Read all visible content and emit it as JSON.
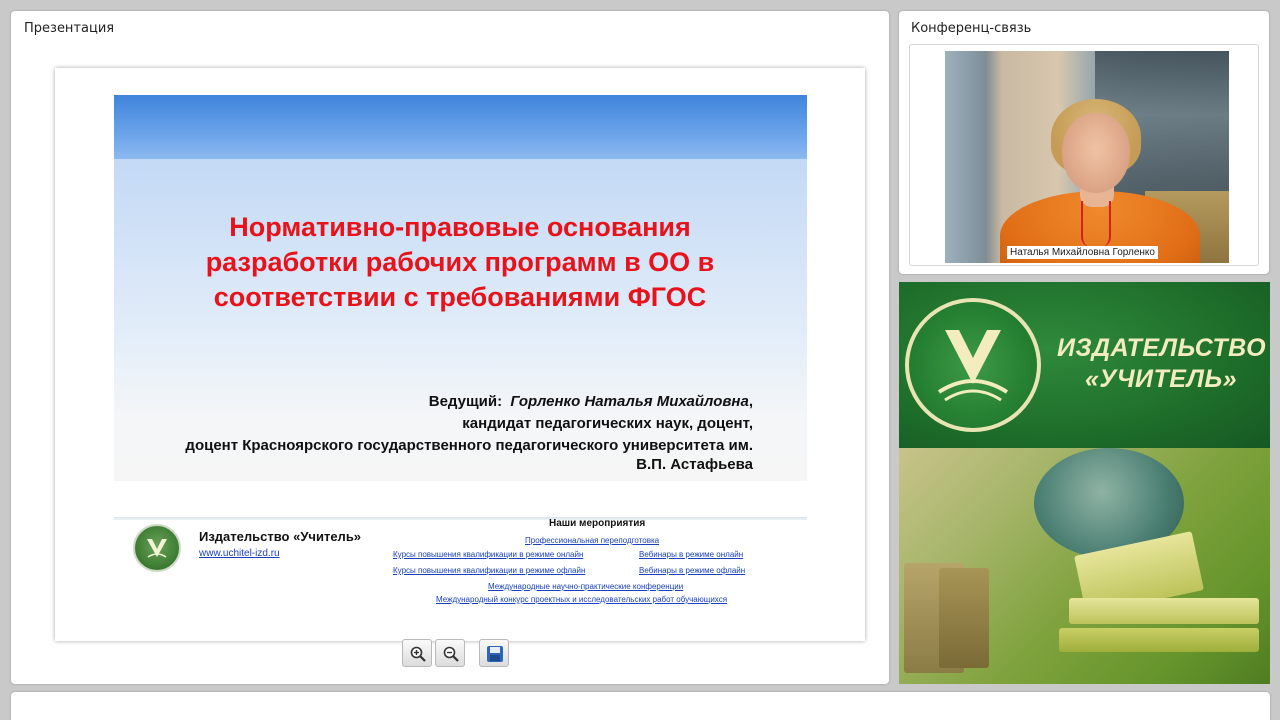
{
  "presentation_panel": {
    "title": "Презентация",
    "slide": {
      "title_lines": [
        "Нормативно-правовые основания",
        "разработки рабочих программ в ОО в",
        "соответствии с требованиями ФГОС"
      ],
      "presenter_label": "Ведущий:",
      "presenter_name": "Горленко  Наталья Михайловна",
      "presenter_line2": "кандидат педагогических наук, доцент,",
      "presenter_line3": "доцент Красноярского  государственного педагогического университета им.",
      "presenter_line4": "В.П. Астафьева",
      "footer": {
        "publisher": "Издательство «Учитель»",
        "site": "www.uchitel-izd.ru",
        "events_heading": "Наши мероприятия",
        "events": [
          "Профессиональная переподготовка",
          "Курсы повышения квалификации в режиме онлайн",
          "Вебинары в режиме онлайн",
          "Курсы повышения квалификации в режиме офлайн",
          "Вебинары в режиме офлайн",
          "Международные научно-практические конференции",
          "Международный конкурс проектных и исследовательских работ обучающихся"
        ]
      }
    },
    "toolbar": {
      "zoom_in": "zoom-in-icon",
      "zoom_out": "zoom-out-icon",
      "save": "save-icon"
    }
  },
  "conference_panel": {
    "title": "Конференц-связь",
    "participant_name": "Наталья Михайловна Горленко"
  },
  "banner": {
    "line1": "ИЗДАТЕЛЬСТВО",
    "line2": "«УЧИТЕЛЬ»"
  },
  "colors": {
    "slide_title": "#e8131a",
    "banner_green": "#1e6e2a",
    "banner_text": "#f2ecbf",
    "link": "#1a3fbf"
  }
}
